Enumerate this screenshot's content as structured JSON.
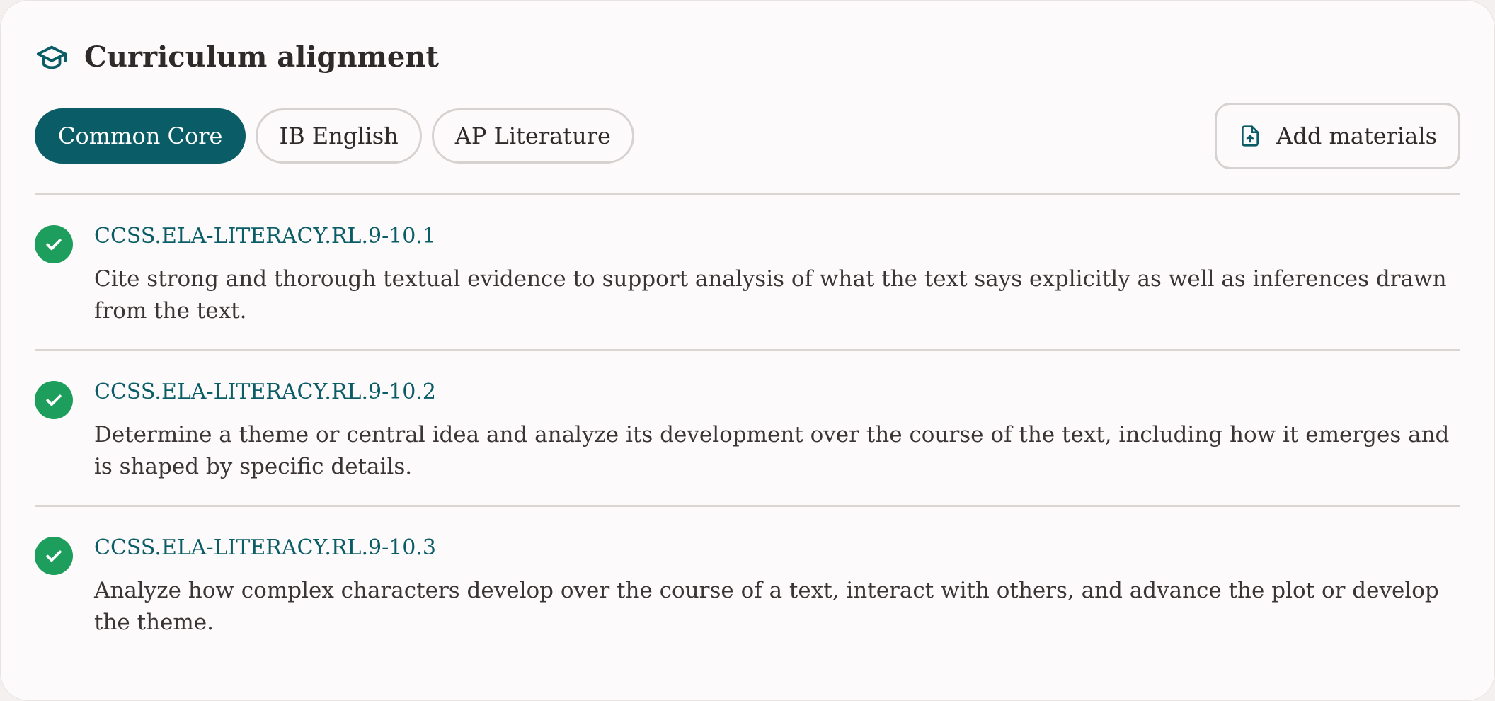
{
  "header": {
    "title": "Curriculum alignment",
    "icon": "graduation-cap-icon"
  },
  "tabs": [
    {
      "label": "Common Core",
      "active": true
    },
    {
      "label": "IB English",
      "active": false
    },
    {
      "label": "AP Literature",
      "active": false
    }
  ],
  "actions": {
    "add_materials_label": "Add materials",
    "add_materials_icon": "file-upload-icon"
  },
  "standards": [
    {
      "code": "CCSS.ELA-LITERACY.RL.9-10.1",
      "description": "Cite strong and thorough textual evidence to support analysis of what the text says explicitly as well as inferences drawn from the text.",
      "status": "check-circle-icon"
    },
    {
      "code": "CCSS.ELA-LITERACY.RL.9-10.2",
      "description": "Determine a theme or central idea and analyze its development over the course of the text, including how it emerges and is shaped by specific details.",
      "status": "check-circle-icon"
    },
    {
      "code": "CCSS.ELA-LITERACY.RL.9-10.3",
      "description": "Analyze how complex characters develop over the course of a text, interact with others, and advance the plot or develop the theme.",
      "status": "check-circle-icon"
    }
  ],
  "colors": {
    "accent": "#0a5c66",
    "success": "#1e9e5c",
    "border": "#d6d2d0",
    "background": "#fcfafa"
  }
}
